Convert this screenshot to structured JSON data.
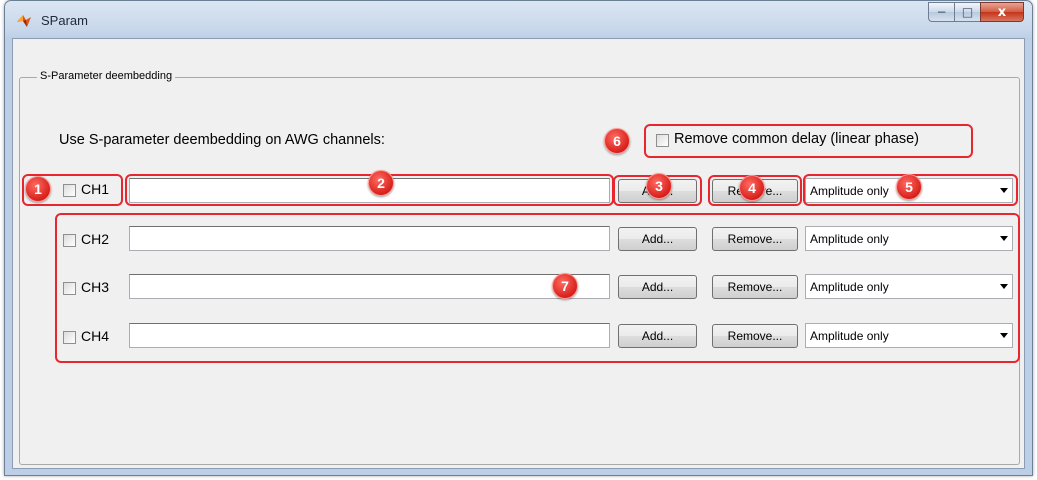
{
  "window": {
    "title": "SParam",
    "controls": {
      "minimize": "−",
      "maximize": "□",
      "close": "x"
    }
  },
  "group": {
    "legend": "S-Parameter deembedding",
    "prompt": "Use S-parameter deembedding on AWG channels:",
    "common_delay_label": "Remove common delay (linear phase)",
    "common_delay_checked": false
  },
  "channels": [
    {
      "label": "CH1",
      "checked": false,
      "file": "",
      "add_label": "Add...",
      "remove_label": "Remove...",
      "mode": "Amplitude only"
    },
    {
      "label": "CH2",
      "checked": false,
      "file": "",
      "add_label": "Add...",
      "remove_label": "Remove...",
      "mode": "Amplitude only"
    },
    {
      "label": "CH3",
      "checked": false,
      "file": "",
      "add_label": "Add...",
      "remove_label": "Remove...",
      "mode": "Amplitude only"
    },
    {
      "label": "CH4",
      "checked": false,
      "file": "",
      "add_label": "Add...",
      "remove_label": "Remove...",
      "mode": "Amplitude only"
    }
  ],
  "callouts": [
    "1",
    "2",
    "3",
    "4",
    "5",
    "6",
    "7"
  ],
  "colors": {
    "callout_red": "#e8262f",
    "window_frame": "#bccfe6",
    "client_bg": "#f0f0f0"
  }
}
